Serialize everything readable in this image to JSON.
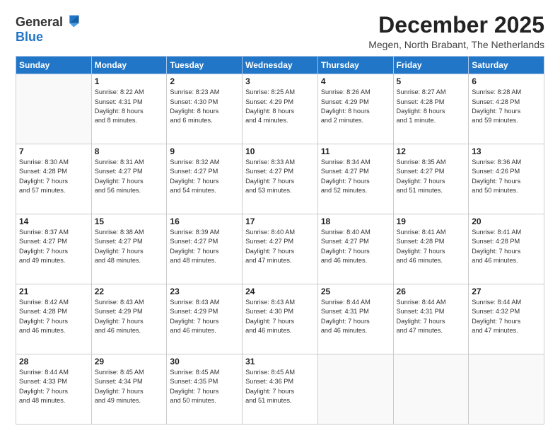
{
  "logo": {
    "general": "General",
    "blue": "Blue"
  },
  "title": "December 2025",
  "location": "Megen, North Brabant, The Netherlands",
  "days_header": [
    "Sunday",
    "Monday",
    "Tuesday",
    "Wednesday",
    "Thursday",
    "Friday",
    "Saturday"
  ],
  "weeks": [
    [
      {
        "day": "",
        "text": ""
      },
      {
        "day": "1",
        "text": "Sunrise: 8:22 AM\nSunset: 4:31 PM\nDaylight: 8 hours\nand 8 minutes."
      },
      {
        "day": "2",
        "text": "Sunrise: 8:23 AM\nSunset: 4:30 PM\nDaylight: 8 hours\nand 6 minutes."
      },
      {
        "day": "3",
        "text": "Sunrise: 8:25 AM\nSunset: 4:29 PM\nDaylight: 8 hours\nand 4 minutes."
      },
      {
        "day": "4",
        "text": "Sunrise: 8:26 AM\nSunset: 4:29 PM\nDaylight: 8 hours\nand 2 minutes."
      },
      {
        "day": "5",
        "text": "Sunrise: 8:27 AM\nSunset: 4:28 PM\nDaylight: 8 hours\nand 1 minute."
      },
      {
        "day": "6",
        "text": "Sunrise: 8:28 AM\nSunset: 4:28 PM\nDaylight: 7 hours\nand 59 minutes."
      }
    ],
    [
      {
        "day": "7",
        "text": "Sunrise: 8:30 AM\nSunset: 4:28 PM\nDaylight: 7 hours\nand 57 minutes."
      },
      {
        "day": "8",
        "text": "Sunrise: 8:31 AM\nSunset: 4:27 PM\nDaylight: 7 hours\nand 56 minutes."
      },
      {
        "day": "9",
        "text": "Sunrise: 8:32 AM\nSunset: 4:27 PM\nDaylight: 7 hours\nand 54 minutes."
      },
      {
        "day": "10",
        "text": "Sunrise: 8:33 AM\nSunset: 4:27 PM\nDaylight: 7 hours\nand 53 minutes."
      },
      {
        "day": "11",
        "text": "Sunrise: 8:34 AM\nSunset: 4:27 PM\nDaylight: 7 hours\nand 52 minutes."
      },
      {
        "day": "12",
        "text": "Sunrise: 8:35 AM\nSunset: 4:27 PM\nDaylight: 7 hours\nand 51 minutes."
      },
      {
        "day": "13",
        "text": "Sunrise: 8:36 AM\nSunset: 4:26 PM\nDaylight: 7 hours\nand 50 minutes."
      }
    ],
    [
      {
        "day": "14",
        "text": "Sunrise: 8:37 AM\nSunset: 4:27 PM\nDaylight: 7 hours\nand 49 minutes."
      },
      {
        "day": "15",
        "text": "Sunrise: 8:38 AM\nSunset: 4:27 PM\nDaylight: 7 hours\nand 48 minutes."
      },
      {
        "day": "16",
        "text": "Sunrise: 8:39 AM\nSunset: 4:27 PM\nDaylight: 7 hours\nand 48 minutes."
      },
      {
        "day": "17",
        "text": "Sunrise: 8:40 AM\nSunset: 4:27 PM\nDaylight: 7 hours\nand 47 minutes."
      },
      {
        "day": "18",
        "text": "Sunrise: 8:40 AM\nSunset: 4:27 PM\nDaylight: 7 hours\nand 46 minutes."
      },
      {
        "day": "19",
        "text": "Sunrise: 8:41 AM\nSunset: 4:28 PM\nDaylight: 7 hours\nand 46 minutes."
      },
      {
        "day": "20",
        "text": "Sunrise: 8:41 AM\nSunset: 4:28 PM\nDaylight: 7 hours\nand 46 minutes."
      }
    ],
    [
      {
        "day": "21",
        "text": "Sunrise: 8:42 AM\nSunset: 4:28 PM\nDaylight: 7 hours\nand 46 minutes."
      },
      {
        "day": "22",
        "text": "Sunrise: 8:43 AM\nSunset: 4:29 PM\nDaylight: 7 hours\nand 46 minutes."
      },
      {
        "day": "23",
        "text": "Sunrise: 8:43 AM\nSunset: 4:29 PM\nDaylight: 7 hours\nand 46 minutes."
      },
      {
        "day": "24",
        "text": "Sunrise: 8:43 AM\nSunset: 4:30 PM\nDaylight: 7 hours\nand 46 minutes."
      },
      {
        "day": "25",
        "text": "Sunrise: 8:44 AM\nSunset: 4:31 PM\nDaylight: 7 hours\nand 46 minutes."
      },
      {
        "day": "26",
        "text": "Sunrise: 8:44 AM\nSunset: 4:31 PM\nDaylight: 7 hours\nand 47 minutes."
      },
      {
        "day": "27",
        "text": "Sunrise: 8:44 AM\nSunset: 4:32 PM\nDaylight: 7 hours\nand 47 minutes."
      }
    ],
    [
      {
        "day": "28",
        "text": "Sunrise: 8:44 AM\nSunset: 4:33 PM\nDaylight: 7 hours\nand 48 minutes."
      },
      {
        "day": "29",
        "text": "Sunrise: 8:45 AM\nSunset: 4:34 PM\nDaylight: 7 hours\nand 49 minutes."
      },
      {
        "day": "30",
        "text": "Sunrise: 8:45 AM\nSunset: 4:35 PM\nDaylight: 7 hours\nand 50 minutes."
      },
      {
        "day": "31",
        "text": "Sunrise: 8:45 AM\nSunset: 4:36 PM\nDaylight: 7 hours\nand 51 minutes."
      },
      {
        "day": "",
        "text": ""
      },
      {
        "day": "",
        "text": ""
      },
      {
        "day": "",
        "text": ""
      }
    ]
  ]
}
